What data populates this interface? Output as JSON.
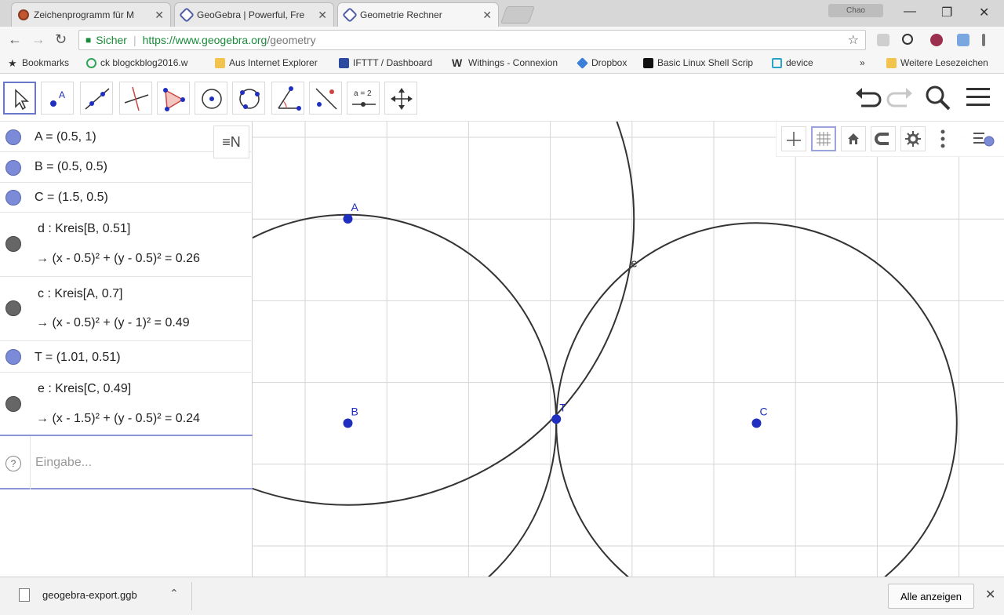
{
  "browser": {
    "tabs": [
      {
        "title": "Zeichenprogramm für M",
        "active": false
      },
      {
        "title": "GeoGebra | Powerful, Fre",
        "active": false
      },
      {
        "title": "Geometrie Rechner",
        "active": true
      }
    ],
    "tab_close": "✕",
    "profile_label": "Chao",
    "window_controls": {
      "minimize": "—",
      "maximize": "❐",
      "close": "✕"
    },
    "nav": {
      "back": "←",
      "forward": "→",
      "reload": "↻"
    },
    "address": {
      "secure_label": "Sicher",
      "url_host": "https://www.geogebra.org",
      "url_path": "/geometry",
      "star": "☆"
    },
    "bookmarks": [
      {
        "label": "Bookmarks",
        "icon": "star-icon",
        "color": "#333333"
      },
      {
        "label": "ck blogckblog2016.w",
        "icon": "globe-icon",
        "color": "#2fa55a"
      },
      {
        "label": "Aus Internet Explorer",
        "icon": "folder-icon",
        "color": "#f2c44e"
      },
      {
        "label": "IFTTT / Dashboard",
        "icon": "ifttt-icon",
        "color": "#2c4aa0"
      },
      {
        "label": "Withings - Connexion",
        "icon": "withings-icon",
        "color": "#111111"
      },
      {
        "label": "Dropbox",
        "icon": "dropbox-icon",
        "color": "#3a7fd8"
      },
      {
        "label": "Basic Linux Shell Scrip",
        "icon": "shell-icon",
        "color": "#111111"
      },
      {
        "label": "device",
        "icon": "device-icon",
        "color": "#2aa3c8"
      },
      {
        "label": "»",
        "icon": "more-icon",
        "color": "#333333"
      },
      {
        "label": "Weitere Lesezeichen",
        "icon": "folder-icon",
        "color": "#f2c44e"
      }
    ]
  },
  "toolbar": {
    "tools": [
      {
        "name": "move-tool",
        "selected": true
      },
      {
        "name": "point-tool",
        "selected": false,
        "label": "A"
      },
      {
        "name": "line-tool",
        "selected": false
      },
      {
        "name": "perpendicular-tool",
        "selected": false
      },
      {
        "name": "polygon-tool",
        "selected": false
      },
      {
        "name": "circle-center-point-tool",
        "selected": false
      },
      {
        "name": "circle-three-points-tool",
        "selected": false
      },
      {
        "name": "angle-tool",
        "selected": false
      },
      {
        "name": "reflect-tool",
        "selected": false
      },
      {
        "name": "slider-tool",
        "selected": false,
        "label": "a = 2"
      },
      {
        "name": "move-view-tool",
        "selected": false
      }
    ],
    "right": {
      "undo": "undo-icon",
      "redo": "redo-icon",
      "search": "search-icon",
      "menu": "menu-icon"
    }
  },
  "algebra": {
    "items": [
      {
        "text": "A = (0.5, 1)",
        "type": "point"
      },
      {
        "text": "B = (0.5, 0.5)",
        "type": "point"
      },
      {
        "text": "C = (1.5, 0.5)",
        "type": "point"
      },
      {
        "text": "d : Kreis[B, 0.51]",
        "formula": "→  (x - 0.5)² + (y - 0.5)² = 0.26",
        "type": "circle"
      },
      {
        "text": "c : Kreis[A, 0.7]",
        "formula": "→  (x - 0.5)² + (y - 1)² = 0.49",
        "type": "circle"
      },
      {
        "text": "T = (1.01, 0.51)",
        "type": "point"
      },
      {
        "text": "e : Kreis[C, 0.49]",
        "formula": "→  (x - 1.5)² + (y - 0.5)² = 0.24",
        "type": "circle"
      }
    ],
    "input_placeholder": "Eingabe...",
    "help_label": "?",
    "algebra_button": "≡N"
  },
  "graphics": {
    "colors": {
      "point": "#1f2fbf",
      "circle": "#333333",
      "grid": "#d6d6d6"
    },
    "labels": {
      "A": "A",
      "B": "B",
      "C": "C",
      "T": "T",
      "e": "e"
    }
  },
  "downloads": {
    "file": "geogebra-export.ggb",
    "chevron": "⌃",
    "show_all": "Alle anzeigen",
    "close": "✕"
  }
}
